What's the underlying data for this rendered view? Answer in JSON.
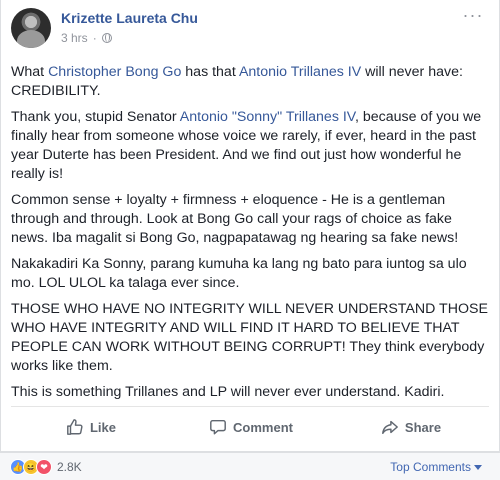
{
  "post": {
    "author": "Krizette Laureta Chu",
    "time": "3 hrs",
    "time_sep": "·",
    "more_icon": "more-dots-icon",
    "paragraphs": [
      {
        "pre": "What ",
        "link1": "Christopher Bong Go",
        "mid": " has that ",
        "link2": "Antonio Trillanes IV",
        "post": " will never have: CREDIBILITY."
      },
      {
        "pre": "Thank you, stupid Senator ",
        "link1": "Antonio \"Sonny\" Trillanes IV",
        "post": ", because of you we finally hear from someone whose voice we rarely, if ever, heard in the past year Duterte has been President. And we find out just how wonderful he really is!"
      },
      {
        "text": "Common sense + loyalty + firmness + eloquence - He is a gentleman through and through. Look at Bong Go call your rags of choice as fake news. Iba magalit si Bong Go, nagpapatawag ng hearing sa fake news!"
      },
      {
        "text": "Nakakadiri Ka Sonny, parang kumuha ka lang ng bato para iuntog sa ulo mo. LOL ULOL ka talaga ever since."
      },
      {
        "text": "THOSE WHO HAVE NO INTEGRITY WILL NEVER UNDERSTAND THOSE WHO HAVE INTEGRITY AND WILL FIND IT HARD TO BELIEVE THAT PEOPLE CAN WORK WITHOUT BEING CORRUPT! They think everybody works like them."
      },
      {
        "text": "This is something Trillanes and LP will never ever understand. Kadiri."
      }
    ]
  },
  "actions": {
    "like": "Like",
    "comment": "Comment",
    "share": "Share"
  },
  "footer": {
    "reactions": [
      "like",
      "haha",
      "love"
    ],
    "count": "2.8K",
    "top_comments": "Top Comments"
  },
  "colors": {
    "link": "#365899",
    "text": "#1d2129",
    "muted": "#90949c",
    "accent": "#4267b2"
  }
}
